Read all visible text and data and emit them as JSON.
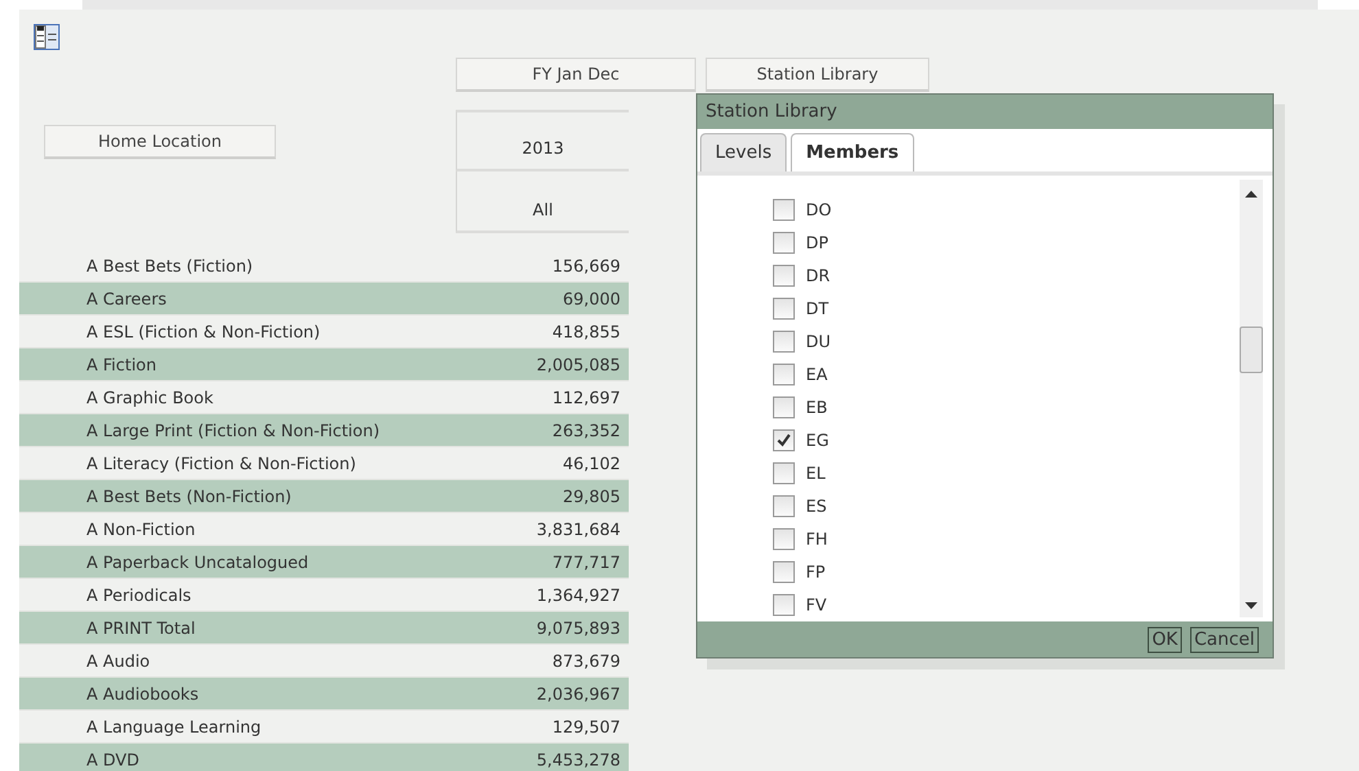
{
  "pivot": {
    "row_header": "Home Location",
    "column_headers": [
      "FY Jan Dec",
      "Station Library"
    ],
    "year": "2013",
    "member": "All",
    "rows": [
      {
        "label": "A Best Bets (Fiction)",
        "value": "156,669"
      },
      {
        "label": "A Careers",
        "value": "69,000"
      },
      {
        "label": "A ESL (Fiction & Non-Fiction)",
        "value": "418,855"
      },
      {
        "label": "A Fiction",
        "value": "2,005,085"
      },
      {
        "label": "A Graphic Book",
        "value": "112,697"
      },
      {
        "label": "A Large Print (Fiction & Non-Fiction)",
        "value": "263,352"
      },
      {
        "label": "A Literacy (Fiction & Non-Fiction)",
        "value": "46,102"
      },
      {
        "label": "A Best Bets (Non-Fiction)",
        "value": "29,805"
      },
      {
        "label": "A Non-Fiction",
        "value": "3,831,684"
      },
      {
        "label": "A Paperback Uncatalogued",
        "value": "777,717"
      },
      {
        "label": "A Periodicals",
        "value": "1,364,927"
      },
      {
        "label": "A PRINT Total",
        "value": "9,075,893"
      },
      {
        "label": "A Audio",
        "value": "873,679"
      },
      {
        "label": "A Audiobooks",
        "value": "2,036,967"
      },
      {
        "label": "A Language Learning",
        "value": "129,507"
      },
      {
        "label": "A DVD",
        "value": "5,453,278"
      }
    ]
  },
  "dialog": {
    "title": "Station Library",
    "tabs": [
      {
        "label": "Levels",
        "selected": false
      },
      {
        "label": "Members",
        "selected": true
      }
    ],
    "members": [
      {
        "label": "DO",
        "checked": false
      },
      {
        "label": "DP",
        "checked": false
      },
      {
        "label": "DR",
        "checked": false
      },
      {
        "label": "DT",
        "checked": false
      },
      {
        "label": "DU",
        "checked": false
      },
      {
        "label": "EA",
        "checked": false
      },
      {
        "label": "EB",
        "checked": false
      },
      {
        "label": "EG",
        "checked": true
      },
      {
        "label": "EL",
        "checked": false
      },
      {
        "label": "ES",
        "checked": false
      },
      {
        "label": "FH",
        "checked": false
      },
      {
        "label": "FP",
        "checked": false
      },
      {
        "label": "FV",
        "checked": false
      }
    ],
    "buttons": [
      "OK",
      "Cancel"
    ]
  }
}
